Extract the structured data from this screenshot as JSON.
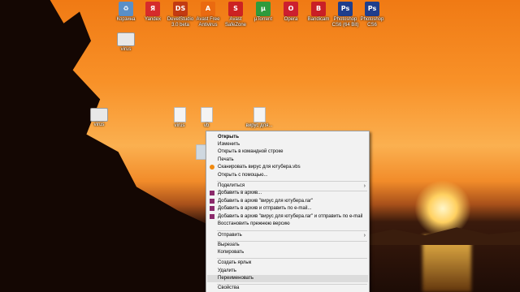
{
  "desktop_icons": [
    {
      "name": "recycle-bin-icon",
      "label": "Корзина",
      "color": "#5a8fc7",
      "glyph": "♻"
    },
    {
      "name": "yandex-icon",
      "label": "Yandex",
      "color": "#d62b2b",
      "glyph": "Я"
    },
    {
      "name": "devel-studio-icon",
      "label": "DevelStudio 3.0 beta",
      "color": "#c23a12",
      "glyph": "DS"
    },
    {
      "name": "avast-icon",
      "label": "Avast Free Antivirus",
      "color": "#ea6a10",
      "glyph": "A"
    },
    {
      "name": "avast-safezone-icon",
      "label": "Avast SafeZone",
      "color": "#cc2222",
      "glyph": "S"
    },
    {
      "name": "utorrent-icon",
      "label": "µTorrent",
      "color": "#2f9a3c",
      "glyph": "µ"
    },
    {
      "name": "opera-icon",
      "label": "Opera",
      "color": "#cc1f2f",
      "glyph": "O"
    },
    {
      "name": "bandicam-icon",
      "label": "Bandicam",
      "color": "#c91f26",
      "glyph": "B"
    },
    {
      "name": "photoshop-x64-icon",
      "label": "Photoshop CS6 (64 Bit)",
      "color": "#1f3e8c",
      "glyph": "Ps"
    },
    {
      "name": "photoshop-icon",
      "label": "Photoshop CS6",
      "color": "#1f3e8c",
      "glyph": "Ps"
    }
  ],
  "items": {
    "folder_virus": "virus",
    "folder2": "virus",
    "file1": "virus",
    "file2": "vb",
    "file3": "вирус для..."
  },
  "menu": {
    "open": "Открыть",
    "edit": "Изменить",
    "open_cmd": "Открыть в  командной строке",
    "print": "Печать",
    "scan": "Сканировать вирус для ютубера.vbs",
    "open_with": "Открыть с помощью...",
    "share": "Поделиться",
    "add_archive": "Добавить в архив...",
    "add_rar": "Добавить в архив \"вирус для ютубера.rar\"",
    "add_email": "Добавить в архив и отправить по e-mail...",
    "add_rar_email": "Добавить в архив \"вирус для ютубера.rar\" и отправить по e-mail",
    "restore": "Восстановить прежнюю версию",
    "send_to": "Отправить",
    "cut": "Вырезать",
    "copy": "Копировать",
    "shortcut": "Создать ярлык",
    "delete": "Удалить",
    "rename": "Переименовать",
    "properties": "Свойства"
  }
}
